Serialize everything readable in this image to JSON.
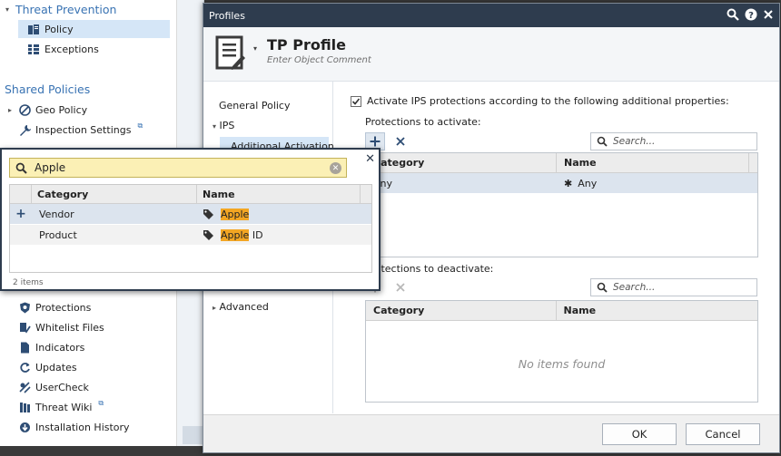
{
  "nav": {
    "threat_prevention": "Threat Prevention",
    "policy": "Policy",
    "exceptions": "Exceptions",
    "shared_policies": "Shared Policies",
    "geo_policy": "Geo Policy",
    "inspection_settings": "Inspection Settings",
    "protections": "Protections",
    "whitelist_files": "Whitelist Files",
    "indicators": "Indicators",
    "updates": "Updates",
    "usercheck": "UserCheck",
    "threat_wiki": "Threat Wiki",
    "installation_history": "Installation History"
  },
  "dialog": {
    "title": "Profiles",
    "profile_name": "TP Profile",
    "comment_placeholder": "Enter Object Comment",
    "nav": {
      "general_policy": "General Policy",
      "ips": "IPS",
      "additional_activation": "Additional Activation",
      "advanced": "Advanced"
    },
    "activate_label": "Activate IPS protections according to the following additional properties:",
    "activate_checked": true,
    "to_activate_label": "Protections to activate:",
    "to_deactivate_label": "Protections to deactivate:",
    "search_placeholder": "Search...",
    "col_category": "Category",
    "col_name": "Name",
    "activate_row": {
      "category": "Any",
      "name": "Any"
    },
    "no_items": "No items found",
    "ok": "OK",
    "cancel": "Cancel"
  },
  "popup": {
    "query": "Apple",
    "col_category": "Category",
    "col_name": "Name",
    "rows": [
      {
        "category": "Vendor",
        "match": "Apple",
        "rest": ""
      },
      {
        "category": "Product",
        "match": "Apple",
        "rest": " ID"
      }
    ],
    "count": "2 items"
  },
  "colors": {
    "title_bar": "#2e3c4e",
    "link_blue": "#3973b3",
    "selection": "#d5e6f7",
    "highlight": "#f3a623",
    "search_bg": "#fbf0b5"
  }
}
